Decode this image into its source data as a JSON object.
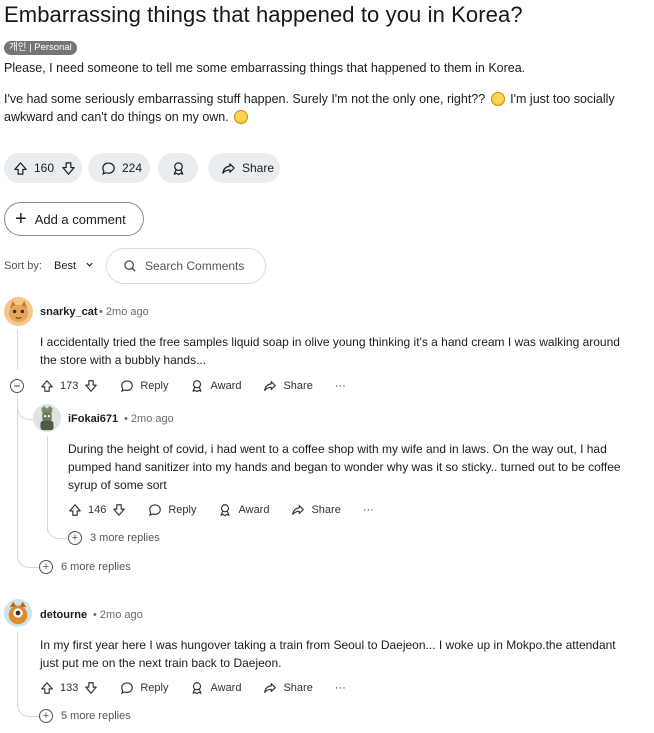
{
  "post": {
    "title": "Embarrassing things that happened to you in Korea?",
    "flair": "개인 | Personal",
    "body_line1": "Please, I need someone to tell me some embarrassing things that happened to them in Korea.",
    "body_line2a": "I've had some seriously embarrassing stuff happen. Surely I'm not the only one, right??",
    "body_line2b": "I'm just too socially",
    "body_line3": "awkward and can't do things on my own.",
    "votes": "160",
    "comments": "224",
    "share_label": "Share"
  },
  "controls": {
    "add_comment": "Add a comment",
    "sort_label": "Sort by:",
    "sort_value": "Best",
    "search_placeholder": "Search Comments"
  },
  "comments": [
    {
      "user": "snarky_cat",
      "age": "2mo ago",
      "line1": "I accidentally tried the free samples liquid soap in olive young thinking it's a hand cream I was walking around",
      "line2": "the store with a bubbly hands...",
      "votes": "173",
      "more_replies": "6 more replies",
      "reply": {
        "user": "iFokai671",
        "age": "2mo ago",
        "line1": "During the height of covid, i had went to a coffee shop with my wife and in laws. On the way out, I had",
        "line2": "pumped hand sanitizer into my hands and began to wonder why was it so sticky.. turned out to be coffee",
        "line3": "syrup of some sort",
        "votes": "146",
        "more_replies": "3 more replies"
      }
    },
    {
      "user": "detourne",
      "age": "2mo ago",
      "line1": "In my first year here I was hungover taking a train from Seoul to Daejeon... I woke up in Mokpo.the attendant",
      "line2": "just put me on the next train back to Daejeon.",
      "votes": "133",
      "more_replies": "5 more replies"
    }
  ],
  "labels": {
    "reply": "Reply",
    "award": "Award",
    "share": "Share",
    "overflow": "···",
    "dot": "•"
  }
}
